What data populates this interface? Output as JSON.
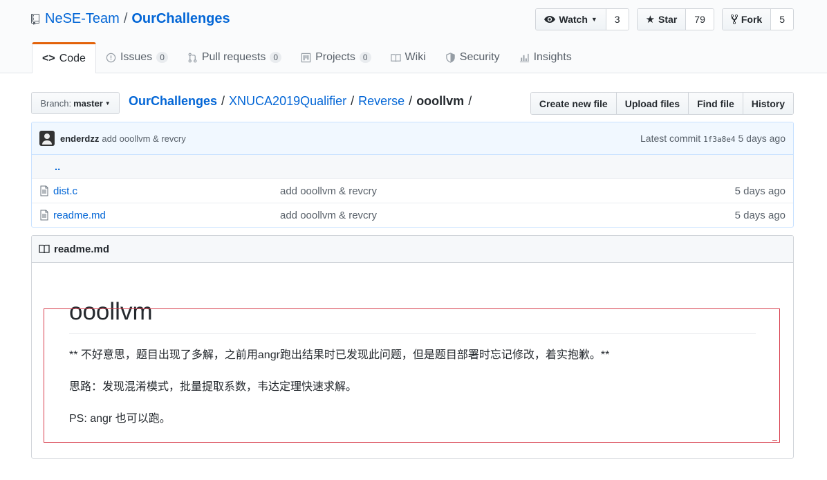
{
  "repo": {
    "owner": "NeSE-Team",
    "separator": "/",
    "name": "OurChallenges"
  },
  "actions": {
    "watch": {
      "label": "Watch",
      "count": "3"
    },
    "star": {
      "label": "Star",
      "count": "79"
    },
    "fork": {
      "label": "Fork",
      "count": "5"
    }
  },
  "tabs": [
    {
      "label": "Code",
      "counter": ""
    },
    {
      "label": "Issues",
      "counter": "0"
    },
    {
      "label": "Pull requests",
      "counter": "0"
    },
    {
      "label": "Projects",
      "counter": "0"
    },
    {
      "label": "Wiki",
      "counter": ""
    },
    {
      "label": "Security",
      "counter": ""
    },
    {
      "label": "Insights",
      "counter": ""
    }
  ],
  "branch": {
    "prefix": "Branch:",
    "value": "master"
  },
  "breadcrumb": [
    "OurChallenges",
    "XNUCA2019Qualifier",
    "Reverse",
    "ooollvm"
  ],
  "file_actions": [
    "Create new file",
    "Upload files",
    "Find file",
    "History"
  ],
  "commit": {
    "author": "enderdzz",
    "message": "add ooollvm & revcry",
    "latest_label": "Latest commit",
    "sha": "1f3a8e4",
    "age": "5 days ago"
  },
  "files": {
    "up": "..",
    "rows": [
      {
        "name": "dist.c",
        "message": "add ooollvm & revcry",
        "age": "5 days ago"
      },
      {
        "name": "readme.md",
        "message": "add ooollvm & revcry",
        "age": "5 days ago"
      }
    ]
  },
  "readme": {
    "filename": "readme.md",
    "title": "ooollvm",
    "paragraphs": [
      "** 不好意思，题目出现了多解，之前用angr跑出结果时已发现此问题，但是题目部署时忘记修改，着实抱歉。**",
      "思路：发现混淆模式，批量提取系数，韦达定理快速求解。",
      "PS: angr 也可以跑。"
    ]
  },
  "colors": {
    "link": "#0366d6",
    "tab_accent": "#e36209",
    "selection": "#d73a49"
  }
}
